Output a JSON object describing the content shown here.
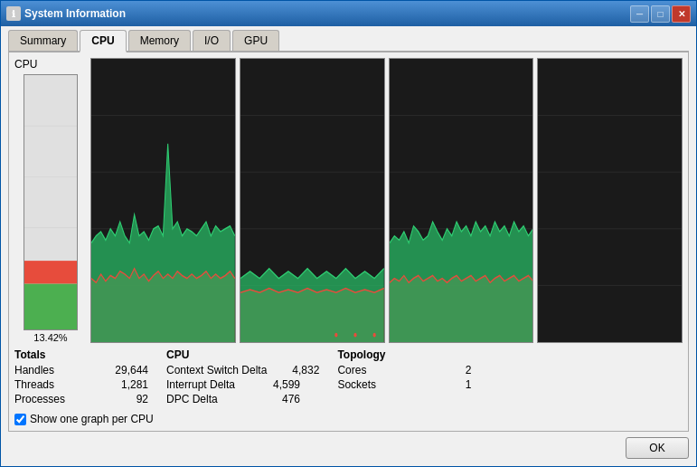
{
  "window": {
    "title": "System Information",
    "icon": "ℹ"
  },
  "titlebar_buttons": {
    "minimize": "─",
    "maximize": "□",
    "close": "✕"
  },
  "tabs": [
    {
      "label": "Summary",
      "active": false
    },
    {
      "label": "CPU",
      "active": true
    },
    {
      "label": "Memory",
      "active": false
    },
    {
      "label": "I/O",
      "active": false
    },
    {
      "label": "GPU",
      "active": false
    }
  ],
  "cpu_section": {
    "label": "CPU",
    "percent": "13.42%"
  },
  "totals": {
    "title": "Totals",
    "rows": [
      {
        "label": "Handles",
        "value": "29,644"
      },
      {
        "label": "Threads",
        "value": "1,281"
      },
      {
        "label": "Processes",
        "value": "92"
      }
    ]
  },
  "cpu_info": {
    "title": "CPU",
    "rows": [
      {
        "label": "Context Switch Delta",
        "value": "4,832"
      },
      {
        "label": "Interrupt Delta",
        "value": "4,599"
      },
      {
        "label": "DPC Delta",
        "value": "476"
      }
    ]
  },
  "topology": {
    "title": "Topology",
    "rows": [
      {
        "label": "Cores",
        "value": "2"
      },
      {
        "label": "Sockets",
        "value": "1"
      }
    ]
  },
  "checkbox": {
    "label": "Show one graph per CPU",
    "checked": true
  },
  "footer": {
    "ok_label": "OK"
  }
}
